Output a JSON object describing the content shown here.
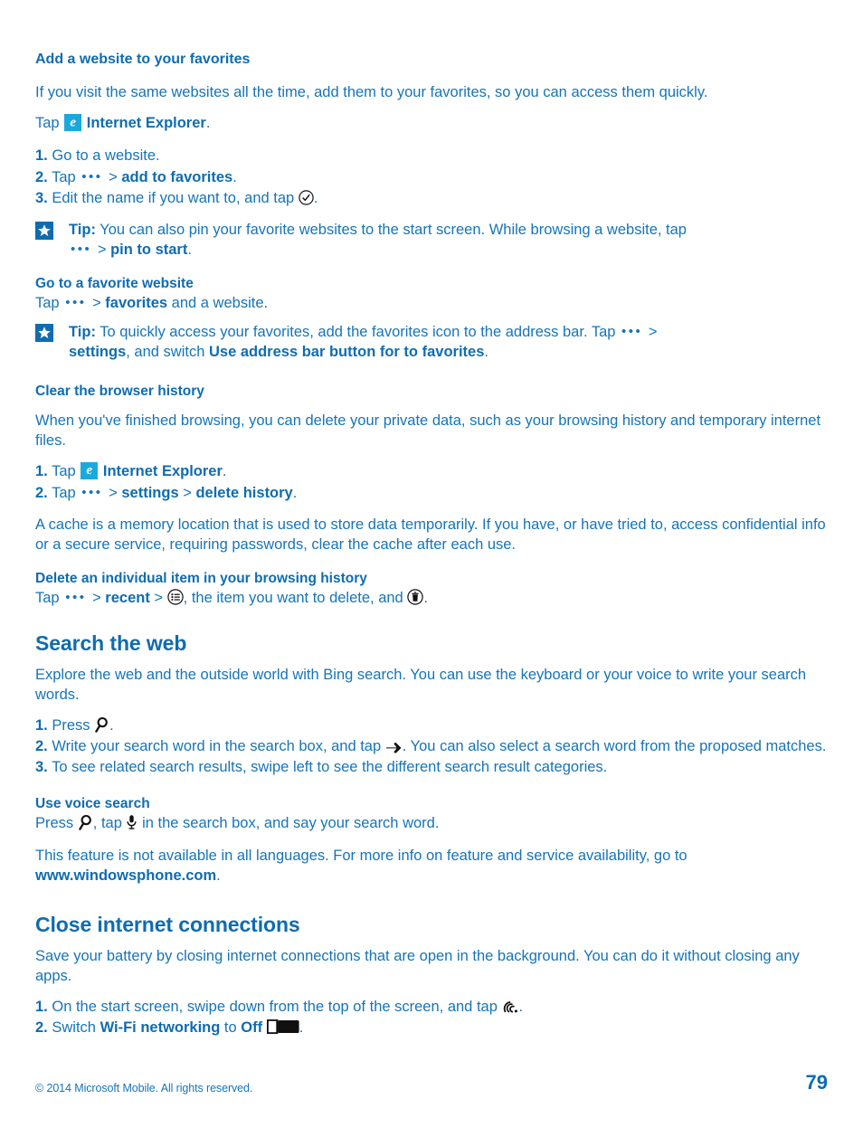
{
  "document": {
    "footer_copyright": "© 2014 Microsoft Mobile. All rights reserved.",
    "page_number": "79",
    "accent_color": "#1674b8",
    "heading_color": "#0f6cb0",
    "ie_tile_color": "#1ba9dd"
  },
  "sections": {
    "add_favorites": {
      "heading": "Add a website to your favorites",
      "intro": "If you visit the same websites all the time, add them to your favorites, so you can access them quickly.",
      "tap_label": "Tap",
      "ie_label": "Internet Explorer",
      "period": ".",
      "steps": [
        {
          "num": "1.",
          "text": "Go to a website."
        },
        {
          "num": "2.",
          "pre": "Tap",
          "menu": "add to favorites",
          "post": "."
        },
        {
          "num": "3.",
          "pre": "Edit the name if you want to, and tap",
          "post": "."
        }
      ],
      "tip": {
        "label": "Tip:",
        "text": "You can also pin your favorite websites to the start screen. While browsing a website, tap",
        "menu": "pin to start",
        "post": "."
      }
    },
    "go_to_favorite": {
      "heading": "Go to a favorite website",
      "line_pre": "Tap",
      "line_menu": "favorites",
      "line_post": "and a website.",
      "tip": {
        "label": "Tip:",
        "text": "To quickly access your favorites, add the favorites icon to the address bar. Tap",
        "menu1": "settings",
        "mid": ", and switch",
        "menu2": "Use address bar button for to favorites",
        "post": "."
      }
    },
    "clear_history": {
      "heading": "Clear the browser history",
      "intro": "When you've finished browsing, you can delete your private data, such as your browsing history and temporary internet files.",
      "steps": [
        {
          "num": "1.",
          "pre": "Tap",
          "ie": "Internet Explorer",
          "post": "."
        },
        {
          "num": "2.",
          "pre": "Tap",
          "menu1": "settings",
          "menu2": "delete history",
          "post": "."
        }
      ],
      "cache_note": "A cache is a memory location that is used to store data temporarily. If you have, or have tried to, access confidential info or a secure service, requiring passwords, clear the cache after each use."
    },
    "delete_item": {
      "heading": "Delete an individual item in your browsing history",
      "pre": "Tap",
      "menu": "recent",
      "mid": ", the item you want to delete, and",
      "post": "."
    },
    "search_web": {
      "heading": "Search the web",
      "intro": "Explore the web and the outside world with Bing search. You can use the keyboard or your voice to write your search words.",
      "steps": [
        {
          "num": "1.",
          "pre": "Press",
          "post": "."
        },
        {
          "num": "2.",
          "pre": "Write your search word in the search box, and tap",
          "post": ". You can also select a search word from the proposed matches."
        },
        {
          "num": "3.",
          "text": "To see related search results, swipe left to see the different search result categories."
        }
      ],
      "voice": {
        "heading": "Use voice search",
        "pre": "Press",
        "mid": ", tap",
        "post": "in the search box, and say your search word."
      },
      "availability": "This feature is not available in all languages. For more info on feature and service availability, go to",
      "link": "www.windowsphone.com",
      "link_period": "."
    },
    "close_connections": {
      "heading": "Close internet connections",
      "intro": "Save your battery by closing internet connections that are open in the background. You can do it without closing any apps.",
      "steps": [
        {
          "num": "1.",
          "pre": "On the start screen, swipe down from the top of the screen, and tap",
          "post": "."
        },
        {
          "num": "2.",
          "pre": "Switch",
          "bold1": "Wi-Fi networking",
          "mid": "to",
          "bold2": "Off",
          "post": "."
        }
      ]
    }
  },
  "icons": {
    "more": "ellipsis-more-icon",
    "ie": "internet-explorer-icon",
    "check": "check-circle-icon",
    "star": "star-tip-icon",
    "select": "select-list-circle-icon",
    "trash": "delete-circle-icon",
    "search": "search-magnifier-icon",
    "arrow": "arrow-right-icon",
    "mic": "microphone-icon",
    "wifi": "wifi-signal-icon",
    "toggle": "toggle-off-icon"
  }
}
